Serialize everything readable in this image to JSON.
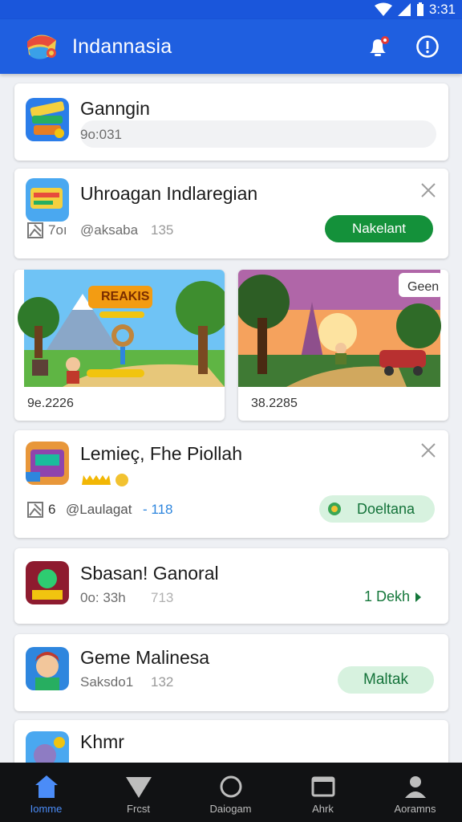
{
  "status": {
    "time": "3:31"
  },
  "appbar": {
    "title": "Indannasia"
  },
  "cards": [
    {
      "title": "Ganngin",
      "meta": "9o:031"
    },
    {
      "title": "Uhroagan Indlaregian",
      "meta_a": "7oı",
      "meta_b": "@aksaba",
      "meta_c": "135",
      "button": "Nakelant"
    },
    {
      "title": "Lemieç, Fhe Piollah",
      "meta_a": "6",
      "meta_b": "@Laulagat",
      "meta_c": "- 118",
      "button": "Doeltana"
    },
    {
      "title": "Sbasan! Ganoral",
      "meta_a": "0o: 33h",
      "meta_b": "713",
      "link": "1 Dekh"
    },
    {
      "title": "Geme Malinesa",
      "meta_a": "Saksdo1",
      "meta_b": "132",
      "button": "Maltak"
    },
    {
      "title": "Khmr"
    }
  ],
  "image_cards": [
    {
      "caption": "9e.2226",
      "banner": "REAKIS"
    },
    {
      "caption": "38.2285",
      "badge": "Geen"
    }
  ],
  "nav": [
    {
      "label": "Iomme",
      "icon": "home-icon",
      "active": true
    },
    {
      "label": "Frcst",
      "icon": "funnel-icon",
      "active": false
    },
    {
      "label": "Daiogam",
      "icon": "circle-icon",
      "active": false
    },
    {
      "label": "Ahrk",
      "icon": "window-icon",
      "active": false
    },
    {
      "label": "Aoramns",
      "icon": "person-icon",
      "active": false
    }
  ],
  "colors": {
    "primary": "#1f5fe0",
    "green": "#14913a",
    "nav_bg": "#111214",
    "active": "#4b8cf7"
  }
}
